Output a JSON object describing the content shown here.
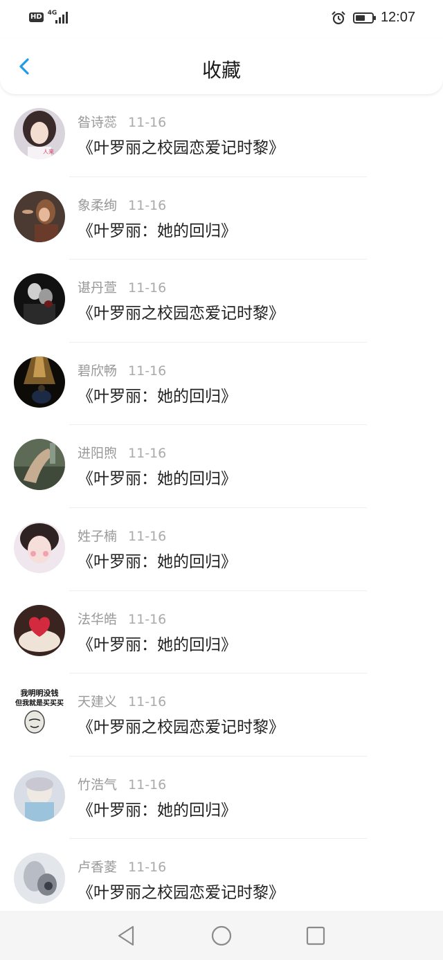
{
  "status_bar": {
    "hd_label": "HD",
    "network_label": "4G",
    "time": "12:07",
    "icons": [
      "hd-icon",
      "signal-icon",
      "alarm-icon",
      "battery-icon"
    ],
    "battery_level": 0.6
  },
  "header": {
    "title": "收藏",
    "back_icon": "chevron-left-icon",
    "accent_color": "#1e9be9"
  },
  "favorites": [
    {
      "author": "昝诗蕊",
      "date": "11-16",
      "title": "《叶罗丽之校园恋爱记时黎》",
      "avatar_icon": "avatar-image"
    },
    {
      "author": "象柔绚",
      "date": "11-16",
      "title": "《叶罗丽：她的回归》",
      "avatar_icon": "avatar-image"
    },
    {
      "author": "谌丹萱",
      "date": "11-16",
      "title": "《叶罗丽之校园恋爱记时黎》",
      "avatar_icon": "avatar-image"
    },
    {
      "author": "碧欣畅",
      "date": "11-16",
      "title": "《叶罗丽：她的回归》",
      "avatar_icon": "avatar-image"
    },
    {
      "author": "进阳煦",
      "date": "11-16",
      "title": "《叶罗丽：她的回归》",
      "avatar_icon": "avatar-image"
    },
    {
      "author": "姓子楠",
      "date": "11-16",
      "title": "《叶罗丽：她的回归》",
      "avatar_icon": "avatar-image"
    },
    {
      "author": "法华皓",
      "date": "11-16",
      "title": "《叶罗丽：她的回归》",
      "avatar_icon": "avatar-image"
    },
    {
      "author": "天建义",
      "date": "11-16",
      "title": "《叶罗丽之校园恋爱记时黎》",
      "avatar_icon": "avatar-image"
    },
    {
      "author": "竹浩气",
      "date": "11-16",
      "title": "《叶罗丽：她的回归》",
      "avatar_icon": "avatar-image"
    },
    {
      "author": "卢香菱",
      "date": "11-16",
      "title": "《叶罗丽之校园恋爱记时黎》",
      "avatar_icon": "avatar-image"
    }
  ],
  "meme_avatar_text": {
    "line1": "我明明没钱",
    "line2": "但我就是买买买"
  },
  "nav_bar": {
    "icons": [
      "back-triangle-icon",
      "home-circle-icon",
      "recents-square-icon"
    ]
  }
}
